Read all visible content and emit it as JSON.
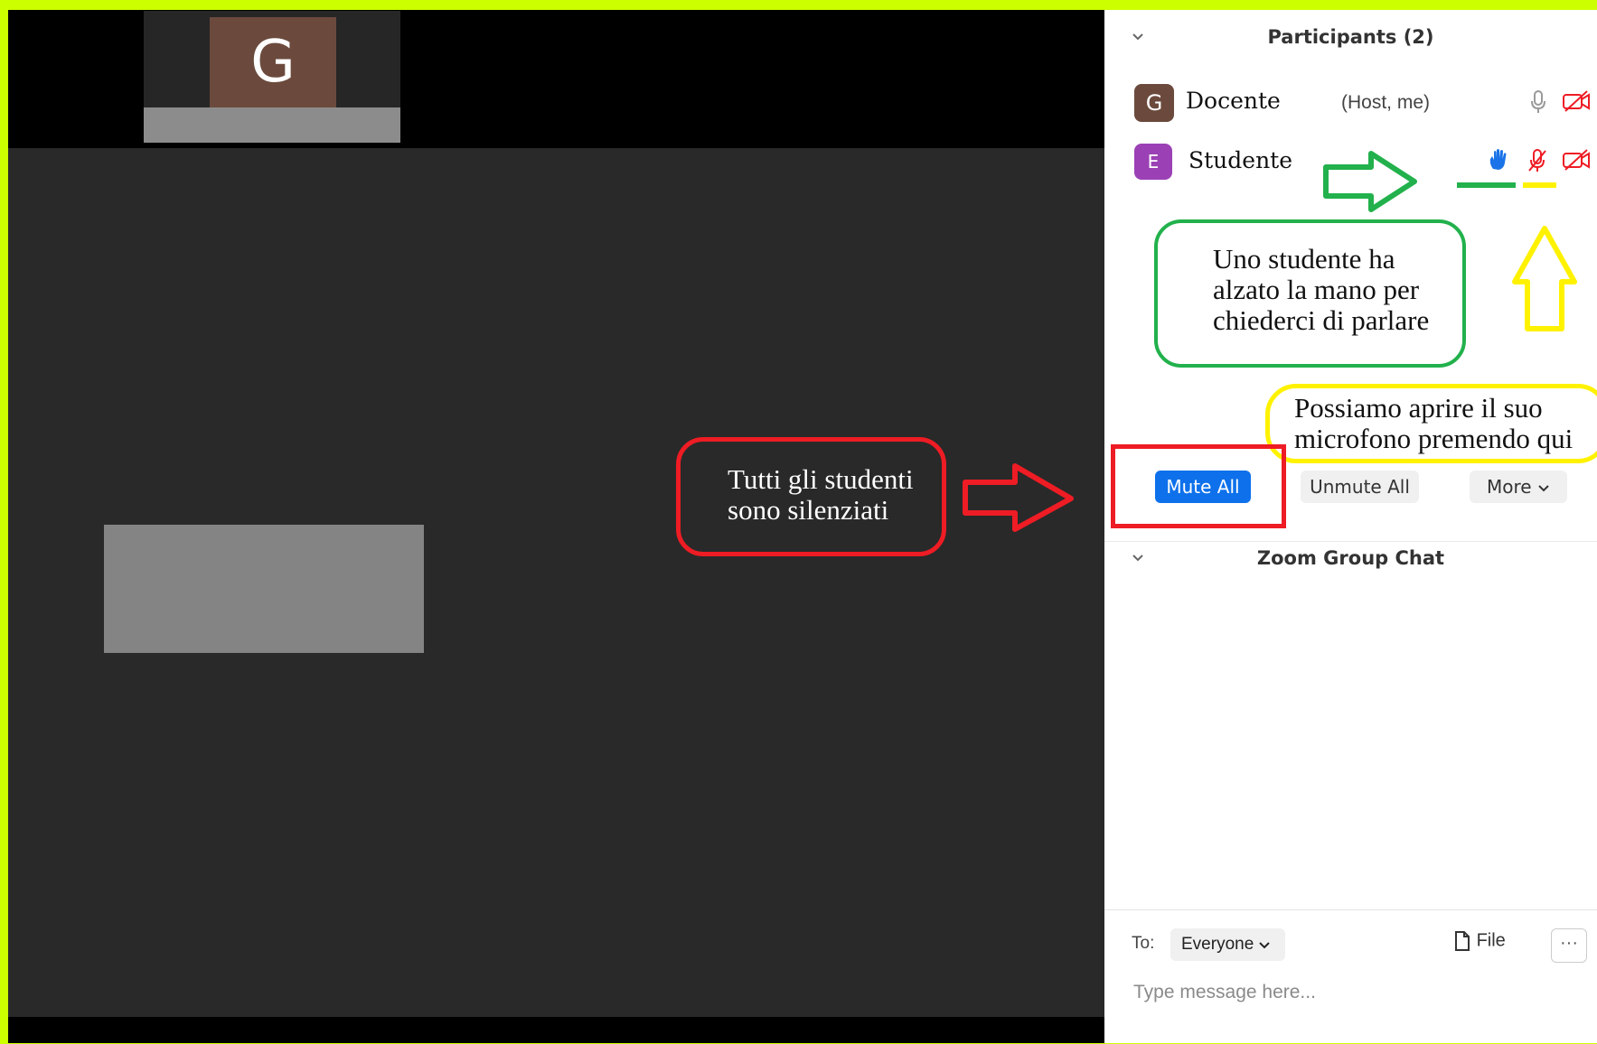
{
  "thumbnail": {
    "avatar_letter": "G"
  },
  "participants": {
    "title": "Participants (2)",
    "rows": [
      {
        "avatar_letter": "G",
        "avatar_color": "#6b4a3d",
        "name": "Docente",
        "role": "(Host, me)",
        "mic": "mic-icon",
        "video": "video-off-icon"
      },
      {
        "avatar_letter": "E",
        "avatar_color": "#9b41b5",
        "name": "Studente",
        "role": "",
        "hand": "raised-hand-icon",
        "mic": "mic-muted-icon",
        "video": "video-off-icon"
      }
    ],
    "buttons": {
      "mute_all": "Mute All",
      "unmute_all": "Unmute All",
      "more": "More"
    }
  },
  "chat": {
    "title": "Zoom Group Chat",
    "to_label": "To:",
    "to_value": "Everyone",
    "file_label": "File",
    "more_label": "···",
    "input_placeholder": "Type message here..."
  },
  "annotations": {
    "red_note": [
      "Tutti gli studenti",
      "sono silenziati"
    ],
    "green_note": [
      "Uno studente ha",
      "alzato la mano per",
      "chiederci di parlare"
    ],
    "yellow_note": [
      "Possiamo aprire il suo",
      "microfono premendo qui"
    ]
  },
  "colors": {
    "background_accent": "#ccff00",
    "primary_button": "#0e71eb",
    "annotation_red": "#ee1c24",
    "annotation_green": "#22b14c",
    "annotation_yellow": "#fff200"
  }
}
